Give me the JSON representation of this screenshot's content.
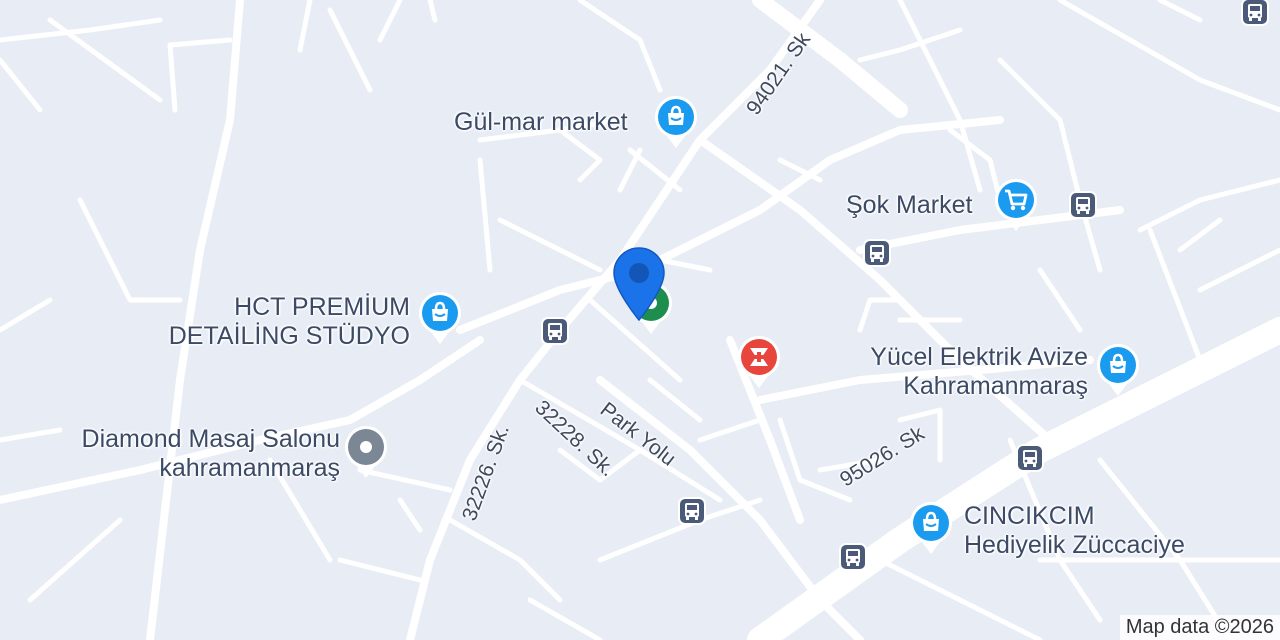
{
  "map": {
    "attribution": "Map data ©2026",
    "places": [
      {
        "id": "gulmar",
        "name": "Gül-mar market",
        "icon": "shopping-bag-icon",
        "color": "#1a9bf0"
      },
      {
        "id": "sok",
        "name": "Şok Market",
        "icon": "shopping-cart-icon",
        "color": "#1a9bf0"
      },
      {
        "id": "hct",
        "name_line1": "HCT PREMİUM",
        "name_line2": "DETAİLİNG STÜDYO",
        "icon": "shopping-bag-icon",
        "color": "#1a9bf0"
      },
      {
        "id": "yucel",
        "name_line1": "Yücel Elektrik Avize",
        "name_line2": "Kahramanmaraş",
        "icon": "shopping-bag-icon",
        "color": "#1a9bf0"
      },
      {
        "id": "diamond",
        "name_line1": "Diamond Masaj Salonu",
        "name_line2": "kahramanmaraş",
        "icon": "place-dot-icon",
        "color": "#7b8794"
      },
      {
        "id": "cincik",
        "name_line1": "CINCIKCIM",
        "name_line2": "Hediyelik Züccaciye",
        "icon": "shopping-bag-icon",
        "color": "#1a9bf0"
      },
      {
        "id": "pharmacy",
        "icon": "pharmacy-icon",
        "color": "#e8453c"
      },
      {
        "id": "park",
        "icon": "park-icon",
        "color": "#1e8e4e"
      }
    ],
    "streets": [
      "94021. Sk",
      "Park Yolu",
      "32228. Sk.",
      "32226. Sk.",
      "95026. Sk"
    ],
    "selected_pin": {
      "icon": "location-pin-icon",
      "color": "#1a73e8"
    },
    "transit_icon": "bus-stop-icon"
  }
}
